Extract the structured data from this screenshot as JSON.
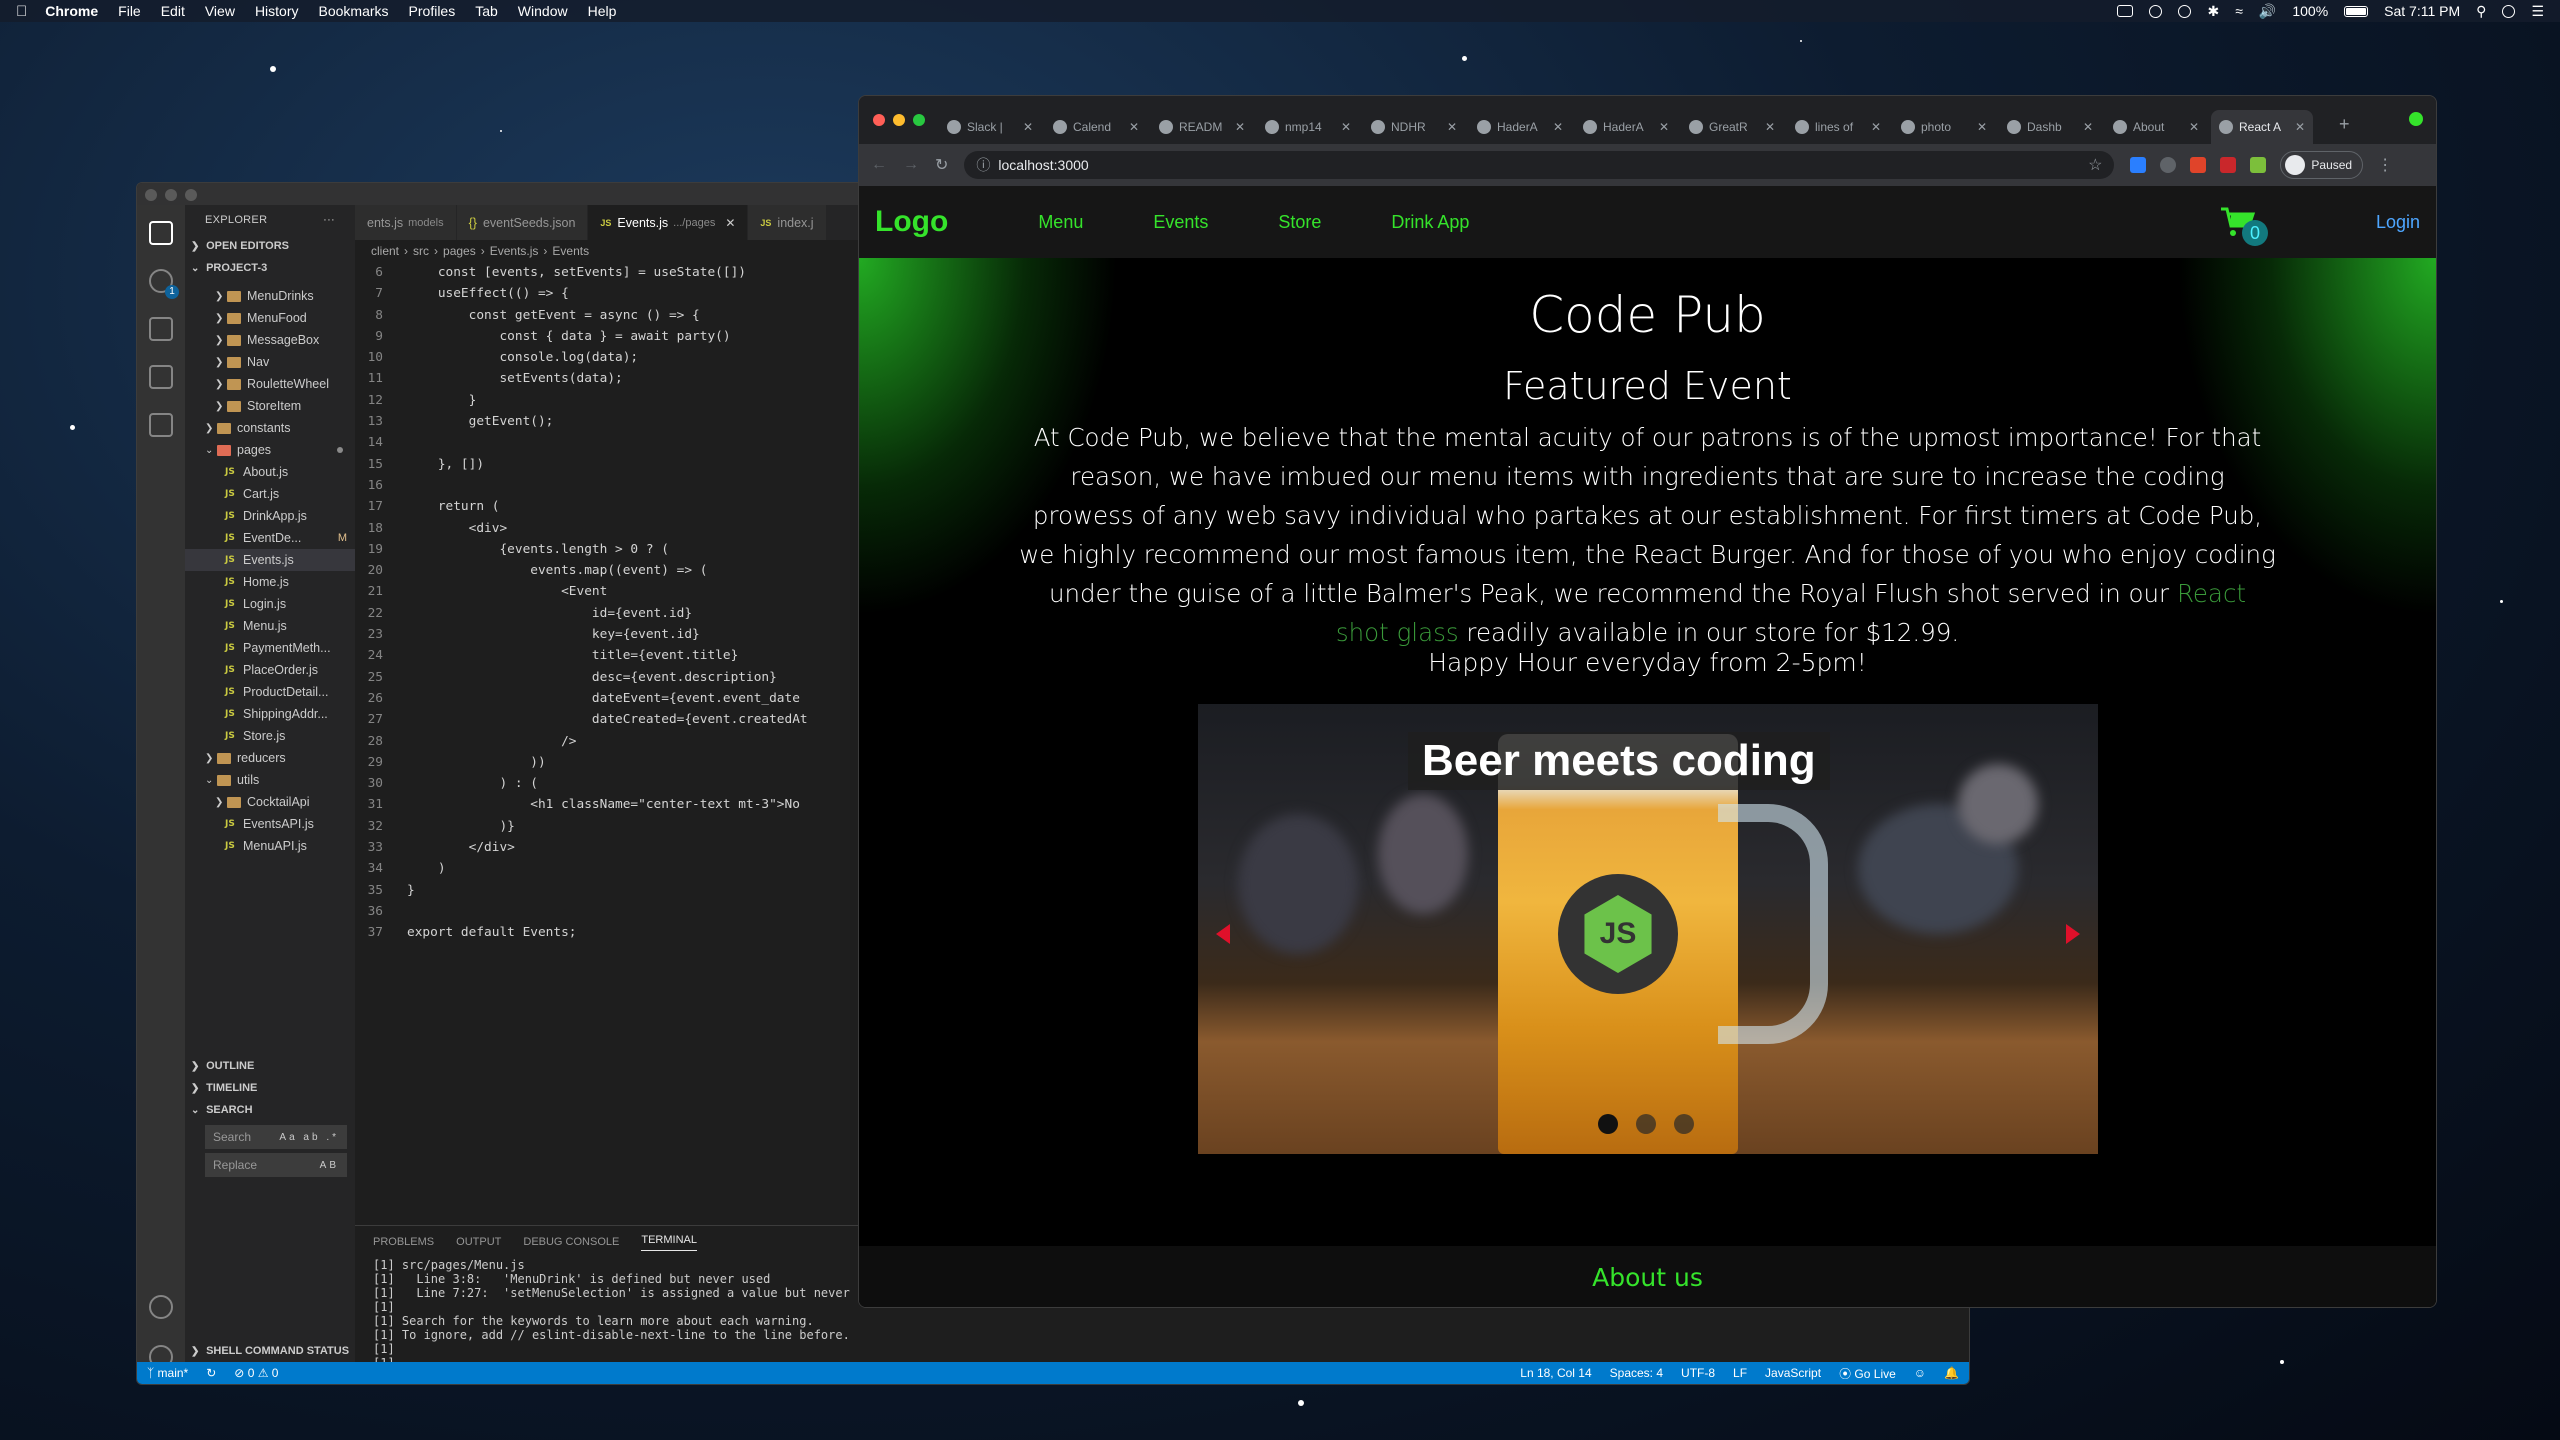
{
  "menubar": {
    "app": "Chrome",
    "items": [
      "File",
      "Edit",
      "View",
      "History",
      "Bookmarks",
      "Profiles",
      "Tab",
      "Window",
      "Help"
    ],
    "battery": "100%",
    "clock": "Sat 7:11 PM"
  },
  "vscode": {
    "explorer_title": "EXPLORER",
    "open_editors": "OPEN EDITORS",
    "project": "PROJECT-3",
    "tree": [
      {
        "type": "folder",
        "label": "MenuDrinks",
        "indent": 2
      },
      {
        "type": "folder",
        "label": "MenuFood",
        "indent": 2
      },
      {
        "type": "folder",
        "label": "MessageBox",
        "indent": 2
      },
      {
        "type": "folder",
        "label": "Nav",
        "indent": 2
      },
      {
        "type": "folder",
        "label": "RouletteWheel",
        "indent": 2
      },
      {
        "type": "folder",
        "label": "StoreItem",
        "indent": 2
      },
      {
        "type": "folder",
        "label": "constants",
        "indent": 1
      },
      {
        "type": "folder-open",
        "label": "pages",
        "indent": 1
      },
      {
        "type": "file",
        "label": "About.js"
      },
      {
        "type": "file",
        "label": "Cart.js"
      },
      {
        "type": "file",
        "label": "DrinkApp.js"
      },
      {
        "type": "file",
        "label": "EventDe...",
        "mod": "M"
      },
      {
        "type": "file",
        "label": "Events.js",
        "selected": true
      },
      {
        "type": "file",
        "label": "Home.js"
      },
      {
        "type": "file",
        "label": "Login.js"
      },
      {
        "type": "file",
        "label": "Menu.js"
      },
      {
        "type": "file",
        "label": "PaymentMeth..."
      },
      {
        "type": "file",
        "label": "PlaceOrder.js"
      },
      {
        "type": "file",
        "label": "ProductDetail..."
      },
      {
        "type": "file",
        "label": "ShippingAddr..."
      },
      {
        "type": "file",
        "label": "Store.js"
      },
      {
        "type": "folder",
        "label": "reducers",
        "indent": 1
      },
      {
        "type": "folder-open",
        "label": "utils",
        "indent": 1
      },
      {
        "type": "folder",
        "label": "CocktailApi",
        "indent": 2
      },
      {
        "type": "file",
        "label": "EventsAPI.js"
      },
      {
        "type": "file",
        "label": "MenuAPI.js"
      }
    ],
    "outline": "OUTLINE",
    "timeline": "TIMELINE",
    "search_section": "SEARCH",
    "search_placeholder": "Search",
    "replace_placeholder": "Replace",
    "shell_section": "SHELL COMMAND STATUS",
    "tabs": [
      {
        "label": "ents.js",
        "desc": "models"
      },
      {
        "label": "eventSeeds.json",
        "desc": ""
      },
      {
        "label": "Events.js",
        "desc": ".../pages",
        "active": true
      },
      {
        "label": "index.j",
        "desc": ""
      }
    ],
    "breadcrumb": [
      "client",
      "src",
      "pages",
      "Events.js",
      "Events"
    ],
    "code_lines": [
      {
        "n": "6",
        "t": "    const [events, setEvents] = useState([])"
      },
      {
        "n": "7",
        "t": "    useEffect(() => {"
      },
      {
        "n": "8",
        "t": "        const getEvent = async () => {"
      },
      {
        "n": "9",
        "t": "            const { data } = await party()"
      },
      {
        "n": "10",
        "t": "            console.log(data);"
      },
      {
        "n": "11",
        "t": "            setEvents(data);"
      },
      {
        "n": "12",
        "t": "        }"
      },
      {
        "n": "13",
        "t": "        getEvent();"
      },
      {
        "n": "14",
        "t": ""
      },
      {
        "n": "15",
        "t": "    }, [])"
      },
      {
        "n": "16",
        "t": ""
      },
      {
        "n": "17",
        "t": "    return ("
      },
      {
        "n": "18",
        "t": "        <div>"
      },
      {
        "n": "19",
        "t": "            {events.length > 0 ? ("
      },
      {
        "n": "20",
        "t": "                events.map((event) => ("
      },
      {
        "n": "21",
        "t": "                    <Event"
      },
      {
        "n": "22",
        "t": "                        id={event.id}"
      },
      {
        "n": "23",
        "t": "                        key={event.id}"
      },
      {
        "n": "24",
        "t": "                        title={event.title}"
      },
      {
        "n": "25",
        "t": "                        desc={event.description}"
      },
      {
        "n": "26",
        "t": "                        dateEvent={event.event_date"
      },
      {
        "n": "27",
        "t": "                        dateCreated={event.createdAt"
      },
      {
        "n": "28",
        "t": "                    />"
      },
      {
        "n": "29",
        "t": "                ))"
      },
      {
        "n": "30",
        "t": "            ) : ("
      },
      {
        "n": "31",
        "t": "                <h1 className=\"center-text mt-3\">No"
      },
      {
        "n": "32",
        "t": "            )}"
      },
      {
        "n": "33",
        "t": "        </div>"
      },
      {
        "n": "34",
        "t": "    )"
      },
      {
        "n": "35",
        "t": "}"
      },
      {
        "n": "36",
        "t": ""
      },
      {
        "n": "37",
        "t": "export default Events;"
      }
    ],
    "panel_tabs": [
      "PROBLEMS",
      "OUTPUT",
      "DEBUG CONSOLE",
      "TERMINAL"
    ],
    "terminal": [
      "[1] src/pages/Menu.js",
      "[1]   Line 3:8:   'MenuDrink' is defined but never used",
      "[1]   Line 7:27:  'setMenuSelection' is assigned a value but never us",
      "[1]",
      "[1] Search for the keywords to learn more about each warning.",
      "[1] To ignore, add // eslint-disable-next-line to the line before.",
      "[1]",
      "[1]"
    ],
    "status": {
      "branch": "main*",
      "problems": "0 ⚠ 0",
      "position": "Ln 18, Col 14",
      "spaces": "Spaces: 4",
      "encoding": "UTF-8",
      "eol": "LF",
      "language": "JavaScript",
      "golive": "Go Live"
    }
  },
  "chrome": {
    "tabs": [
      "Slack |",
      "Calend",
      "READM",
      "nmp14",
      "NDHR",
      "HaderA",
      "HaderA",
      "GreatR",
      "lines of",
      "photo",
      "Dashb",
      "About",
      "React A"
    ],
    "url": "localhost:3000",
    "profile": "Paused"
  },
  "site": {
    "logo": "Logo",
    "nav": [
      "Menu",
      "Events",
      "Store",
      "Drink App"
    ],
    "cart_count": "0",
    "login": "Login",
    "title": "Code Pub",
    "subtitle": "Featured Event",
    "para_1": "At Code Pub, we believe that the mental acuity of our patrons is of the upmost importance! For that reason, we have imbued our menu items with ingredients that are sure to increase the coding prowess of any web savy individual who partakes at our establishment. For first timers at Code Pub, we highly recommend our most famous item, the React Burger. And for those of you who enjoy coding under the guise of a little Balmer's Peak, we recommend the Royal Flush shot served in our ",
    "para_link": "React shot glass",
    "para_2": " readily available in our store for $12.99.",
    "happy_hour": "Happy Hour everyday from 2-5pm!",
    "carousel_caption": "Beer meets coding",
    "carousel_logo": "JS",
    "carousel_active": 1,
    "carousel_total": 3,
    "footer_heading": "About us"
  },
  "colors": {
    "site_green": "#35e32b",
    "login_blue": "#4ea6ff",
    "vscode_blue": "#007acc"
  }
}
